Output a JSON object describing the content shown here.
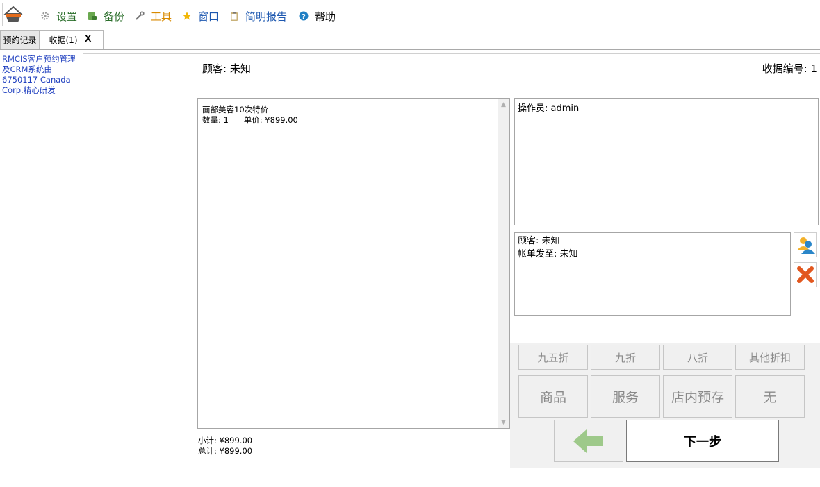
{
  "menu": {
    "items": [
      {
        "label": "设置",
        "icon": "gear-icon",
        "color": "#2a6e2a"
      },
      {
        "label": "备份",
        "icon": "backup-icon",
        "color": "#2a6e2a"
      },
      {
        "label": "工具",
        "icon": "wrench-icon",
        "color": "#d88a00"
      },
      {
        "label": "窗口",
        "icon": "star-icon",
        "color": "#1e58b0"
      },
      {
        "label": "简明报告",
        "icon": "clipboard-icon",
        "color": "#1e58b0"
      },
      {
        "label": "帮助",
        "icon": "help-icon",
        "color": "#000000"
      }
    ]
  },
  "tabs": {
    "records": "预约记录",
    "receipt": "收据(1)",
    "close": "X"
  },
  "sidebar": {
    "info_text": "RMCIS客户预约管理及CRM系统由6750117 Canada Corp.精心研发"
  },
  "header": {
    "customer": "顾客: 未知",
    "receipt_number": "收据编号: 1"
  },
  "items": [
    {
      "name": "面部美容10次特价",
      "detail": "数量: 1      单价: ¥899.00"
    }
  ],
  "totals": {
    "subtotal": "小计: ¥899.00",
    "total": "总计: ¥899.00"
  },
  "operator": {
    "text": "操作员: admin"
  },
  "customer_panel": {
    "customer": "顾客: 未知",
    "bill_to": "帐单发至: 未知"
  },
  "discounts": [
    "九五折",
    "九折",
    "八折",
    "其他折扣"
  ],
  "categories": [
    "商品",
    "服务",
    "店内预存",
    "无"
  ],
  "actions": {
    "next": "下一步"
  },
  "colors": {
    "sidebar_link": "#1f3fbf",
    "back_arrow": "#9ec98a"
  }
}
